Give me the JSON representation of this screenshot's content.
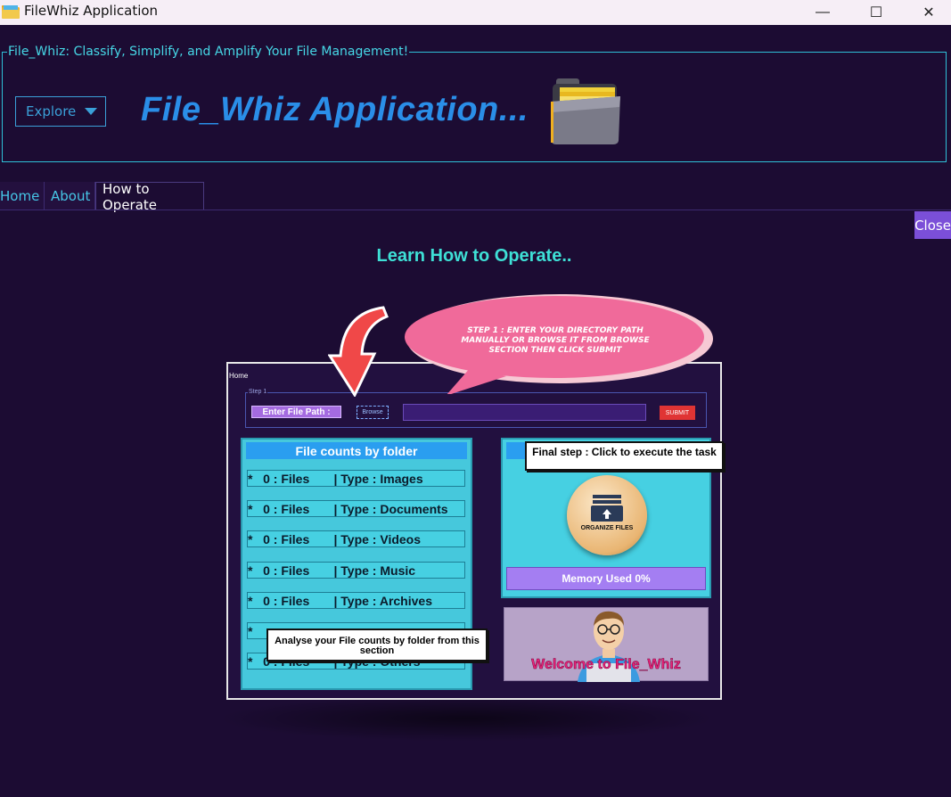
{
  "window": {
    "title": "FileWhiz Application",
    "minimize_glyph": "—",
    "maximize_glyph": "☐",
    "close_glyph": "✕"
  },
  "header": {
    "legend": "File_Whiz: Classify, Simplify, and Amplify Your File Management!",
    "explore_label": "Explore",
    "heading": "File_Whiz Application..."
  },
  "tabs": [
    {
      "label": "Home"
    },
    {
      "label": "About"
    },
    {
      "label": "How to Operate",
      "active": true
    }
  ],
  "close_label": "Close",
  "page_heading": "Learn How to Operate..",
  "tutorial": {
    "home_label": "Home",
    "step_legend": "Step 1",
    "enter_path_label": "Enter File Path :",
    "browse_label": "Browse",
    "submit_label": "SUBMIT",
    "bubble_text": "Step 1 : Enter your Directory path manually or browse it from browse section then click submit",
    "counts_heading": "File counts by folder",
    "count_rows": [
      "*   0 : Files       | Type : Images",
      "*   0 : Files       | Type : Documents",
      "*   0 : Files       | Type : Videos",
      "*   0 : Files       | Type : Music",
      "*   0 : Files       | Type : Archives",
      "*",
      "*   0 : Files       | Type : Others"
    ],
    "final_step_callout": "Final step : Click to execute the task",
    "organize_label": "ORGANIZE FILES",
    "memory_label": "Memory Used 0%",
    "analyse_callout": "Analyse your File counts by folder from this section",
    "welcome_text": "Welcome to File_Whiz"
  },
  "colors": {
    "background": "#1c0c33",
    "accent_cyan": "#46d7e6",
    "heading_blue": "#2a8ee8",
    "close_purple": "#7b4fd8"
  }
}
